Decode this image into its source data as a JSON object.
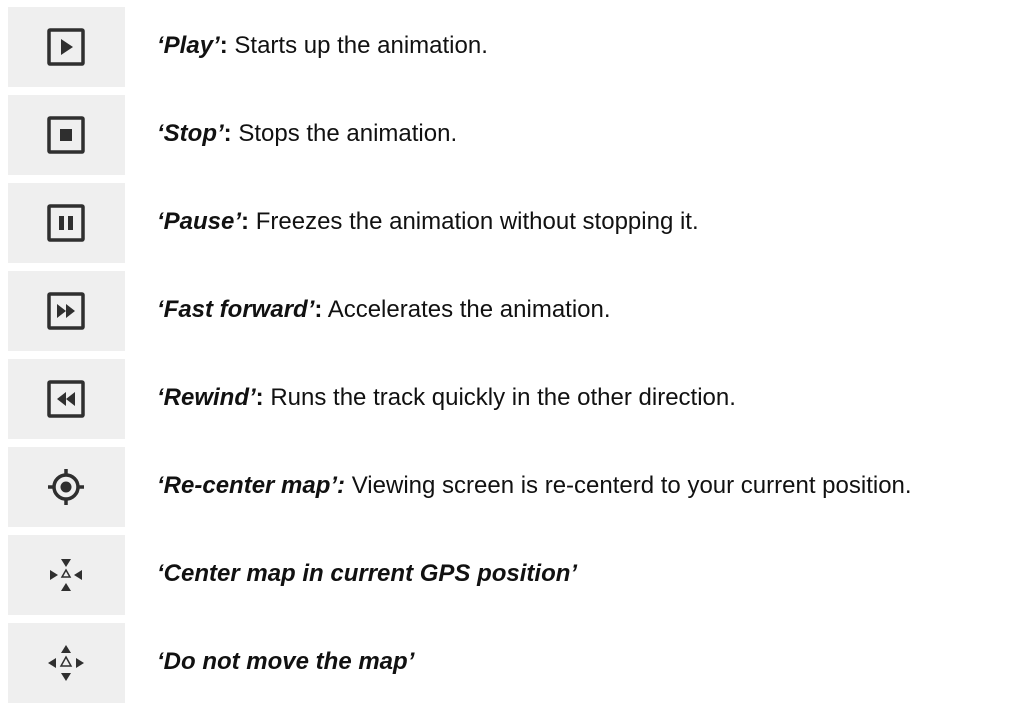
{
  "items": [
    {
      "icon": "play-icon",
      "term": "‘Play’",
      "colon": ":",
      "desc": " Starts up the animation."
    },
    {
      "icon": "stop-icon",
      "term": "‘Stop’",
      "colon": ":",
      "desc": " Stops the animation."
    },
    {
      "icon": "pause-icon",
      "term": "‘Pause’",
      "colon": ":",
      "desc": " Freezes the animation without stopping it."
    },
    {
      "icon": "fast-forward-icon",
      "term": "‘Fast forward’",
      "colon": ":",
      "desc": " Accelerates the animation."
    },
    {
      "icon": "rewind-icon",
      "term": "‘Rewind’",
      "colon": ":",
      "desc": " Runs the track quickly in the other direction."
    },
    {
      "icon": "recenter-map-icon",
      "term": "‘Re-center map’:",
      "colon": "",
      "desc": " Viewing screen is re-centerd to your current position."
    },
    {
      "icon": "center-gps-icon",
      "term": "‘Center map in current GPS position’",
      "colon": "",
      "desc": ""
    },
    {
      "icon": "do-not-move-map-icon",
      "term": "‘Do not move the map’",
      "colon": "",
      "desc": ""
    }
  ],
  "colors": {
    "tile_background": "#efefef",
    "icon_dark": "#2f2f2f",
    "text": "#111111"
  }
}
